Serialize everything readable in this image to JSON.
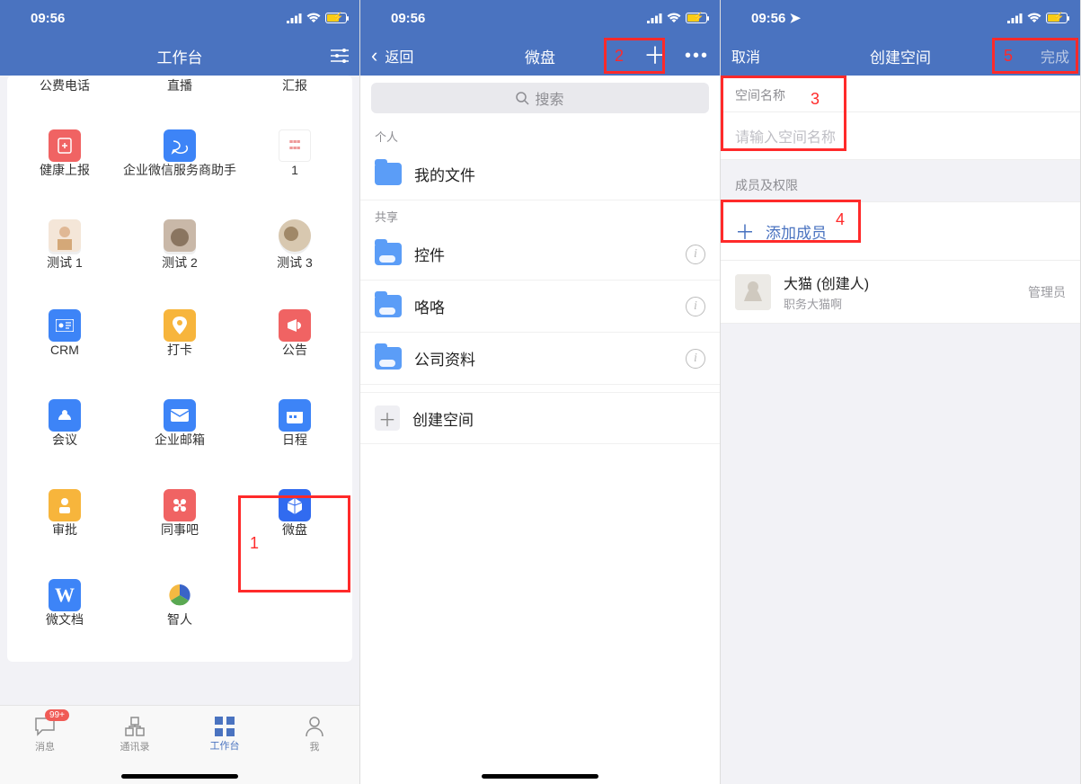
{
  "status": {
    "time": "09:56",
    "time_loc": "09:56 ➤"
  },
  "screen1": {
    "nav": {
      "title": "工作台"
    },
    "apps": [
      {
        "label": "公费电话"
      },
      {
        "label": "直播"
      },
      {
        "label": "汇报"
      },
      {
        "label": "健康上报"
      },
      {
        "label": "企业微信服务商助手"
      },
      {
        "label": "1"
      },
      {
        "label": "测试 1"
      },
      {
        "label": "测试 2"
      },
      {
        "label": "测试 3"
      },
      {
        "label": "CRM"
      },
      {
        "label": "打卡"
      },
      {
        "label": "公告"
      },
      {
        "label": "会议"
      },
      {
        "label": "企业邮箱"
      },
      {
        "label": "日程"
      },
      {
        "label": "审批"
      },
      {
        "label": "同事吧"
      },
      {
        "label": "微盘"
      },
      {
        "label": "微文档"
      },
      {
        "label": "智人"
      }
    ],
    "tabs": {
      "msg": "消息",
      "badge": "99+",
      "contacts": "通讯录",
      "work": "工作台",
      "me": "我"
    },
    "anno": {
      "one": "1"
    }
  },
  "screen2": {
    "nav": {
      "back": "返回",
      "title": "微盘"
    },
    "search_placeholder": "搜索",
    "sections": {
      "personal": "个人",
      "shared": "共享"
    },
    "my_files": "我的文件",
    "shared_items": [
      {
        "label": "控件"
      },
      {
        "label": "咯咯"
      },
      {
        "label": "公司资料"
      }
    ],
    "create_space": "创建空间",
    "anno": {
      "two": "2"
    }
  },
  "screen3": {
    "nav": {
      "cancel": "取消",
      "title": "创建空间",
      "done": "完成"
    },
    "labels": {
      "name": "空间名称",
      "members": "成员及权限"
    },
    "name_placeholder": "请输入空间名称",
    "add_member": "添加成员",
    "member": {
      "name": "大猫 (创建人)",
      "sub": "职务大猫啊",
      "role": "管理员"
    },
    "anno": {
      "three": "3",
      "four": "4",
      "five": "5"
    }
  }
}
